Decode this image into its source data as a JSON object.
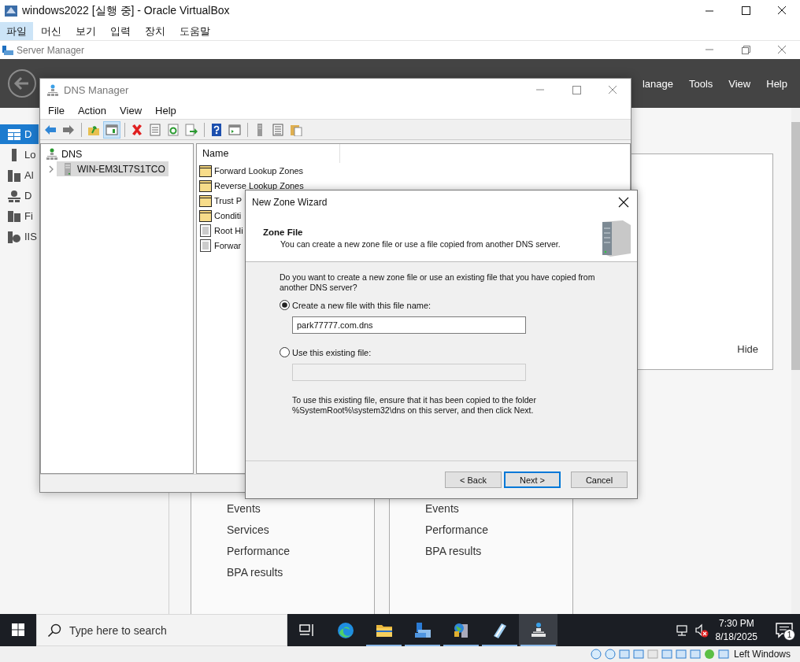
{
  "vbox": {
    "title": "windows2022 [실행 중] - Oracle VirtualBox",
    "menu": [
      {
        "label": "파일",
        "selected": true
      },
      {
        "label": "머신",
        "selected": false
      },
      {
        "label": "보기",
        "selected": false
      },
      {
        "label": "입력",
        "selected": false
      },
      {
        "label": "장치",
        "selected": false
      },
      {
        "label": "도움말",
        "selected": false
      }
    ],
    "status_text": "Left Windows"
  },
  "server_manager": {
    "title": "Server Manager",
    "menu": [
      "lanage",
      "Tools",
      "View",
      "Help"
    ],
    "sidebar": [
      {
        "kind": "dashboard",
        "label": "D",
        "selected": true
      },
      {
        "kind": "local",
        "label": "Lo",
        "selected": false
      },
      {
        "kind": "all",
        "label": "Al",
        "selected": false
      },
      {
        "kind": "dns",
        "label": "D",
        "selected": false
      },
      {
        "kind": "files",
        "label": "Fi",
        "selected": false
      },
      {
        "kind": "iis",
        "label": "IIS",
        "selected": false
      }
    ],
    "panel_action": "Hide",
    "tiles": [
      {
        "links": [
          "Events",
          "Services",
          "Performance",
          "BPA results"
        ]
      },
      {
        "links": [
          "Events",
          "Performance",
          "BPA results"
        ]
      }
    ]
  },
  "dns_manager": {
    "title": "DNS Manager",
    "menu": [
      "File",
      "Action",
      "View",
      "Help"
    ],
    "toolbar": [
      {
        "kind": "back",
        "pressed": false
      },
      {
        "kind": "forward",
        "pressed": false
      },
      {
        "kind": "separator"
      },
      {
        "kind": "up",
        "pressed": false
      },
      {
        "kind": "tree",
        "pressed": true
      },
      {
        "kind": "separator"
      },
      {
        "kind": "delete",
        "pressed": false
      },
      {
        "kind": "properties",
        "pressed": false
      },
      {
        "kind": "refresh",
        "pressed": false
      },
      {
        "kind": "export",
        "pressed": false
      },
      {
        "kind": "separator"
      },
      {
        "kind": "help",
        "pressed": false
      },
      {
        "kind": "console",
        "pressed": false
      },
      {
        "kind": "separator"
      },
      {
        "kind": "server",
        "pressed": false
      },
      {
        "kind": "list",
        "pressed": false
      },
      {
        "kind": "paste",
        "pressed": false
      }
    ],
    "tree": {
      "root": "DNS",
      "children": [
        {
          "label": "WIN-EM3LT7S1TCO",
          "selected": true,
          "expanded": false
        }
      ]
    },
    "list": {
      "columns": [
        "Name"
      ],
      "rows": [
        {
          "name": "Forward Lookup Zones",
          "kind": "folder"
        },
        {
          "name": "Reverse Lookup Zones",
          "kind": "folder"
        },
        {
          "name": "Trust P",
          "kind": "folder"
        },
        {
          "name": "Conditi",
          "kind": "folder"
        },
        {
          "name": "Root Hi",
          "kind": "records"
        },
        {
          "name": "Forwar",
          "kind": "records"
        }
      ]
    }
  },
  "wizard": {
    "title": "New Zone Wizard",
    "heading": "Zone File",
    "subtitle": "You can create a new zone file or use a file copied from another DNS server.",
    "question": "Do you want to create a new zone file or use an existing file that you have copied from another DNS server?",
    "options": [
      {
        "label": "Create a new file with this file name:",
        "selected": true,
        "field": {
          "value": "park77777.com.dns",
          "disabled": false
        }
      },
      {
        "label": "Use this existing file:",
        "selected": false,
        "field": {
          "disabled": true
        }
      }
    ],
    "note": "To use this existing file, ensure that it has been copied to the folder %SystemRoot%\\system32\\dns on this server, and then click Next.",
    "buttons": [
      {
        "label": "< Back",
        "default": false
      },
      {
        "label": "Next >",
        "default": true
      },
      {
        "label": "Cancel",
        "default": false
      }
    ]
  },
  "taskbar": {
    "search_placeholder": "Type here to search",
    "apps": [
      {
        "kind": "task-view",
        "running": false,
        "active": false
      },
      {
        "kind": "browser",
        "running": false,
        "active": false
      },
      {
        "kind": "folder",
        "running": true,
        "active": false
      },
      {
        "kind": "server-manager",
        "running": true,
        "active": false
      },
      {
        "kind": "servers",
        "running": true,
        "active": false
      },
      {
        "kind": "notepad",
        "running": true,
        "active": false
      },
      {
        "kind": "dns",
        "running": true,
        "active": true
      }
    ],
    "time": "7:30 PM",
    "date": "8/18/2025",
    "notifications": "1"
  }
}
